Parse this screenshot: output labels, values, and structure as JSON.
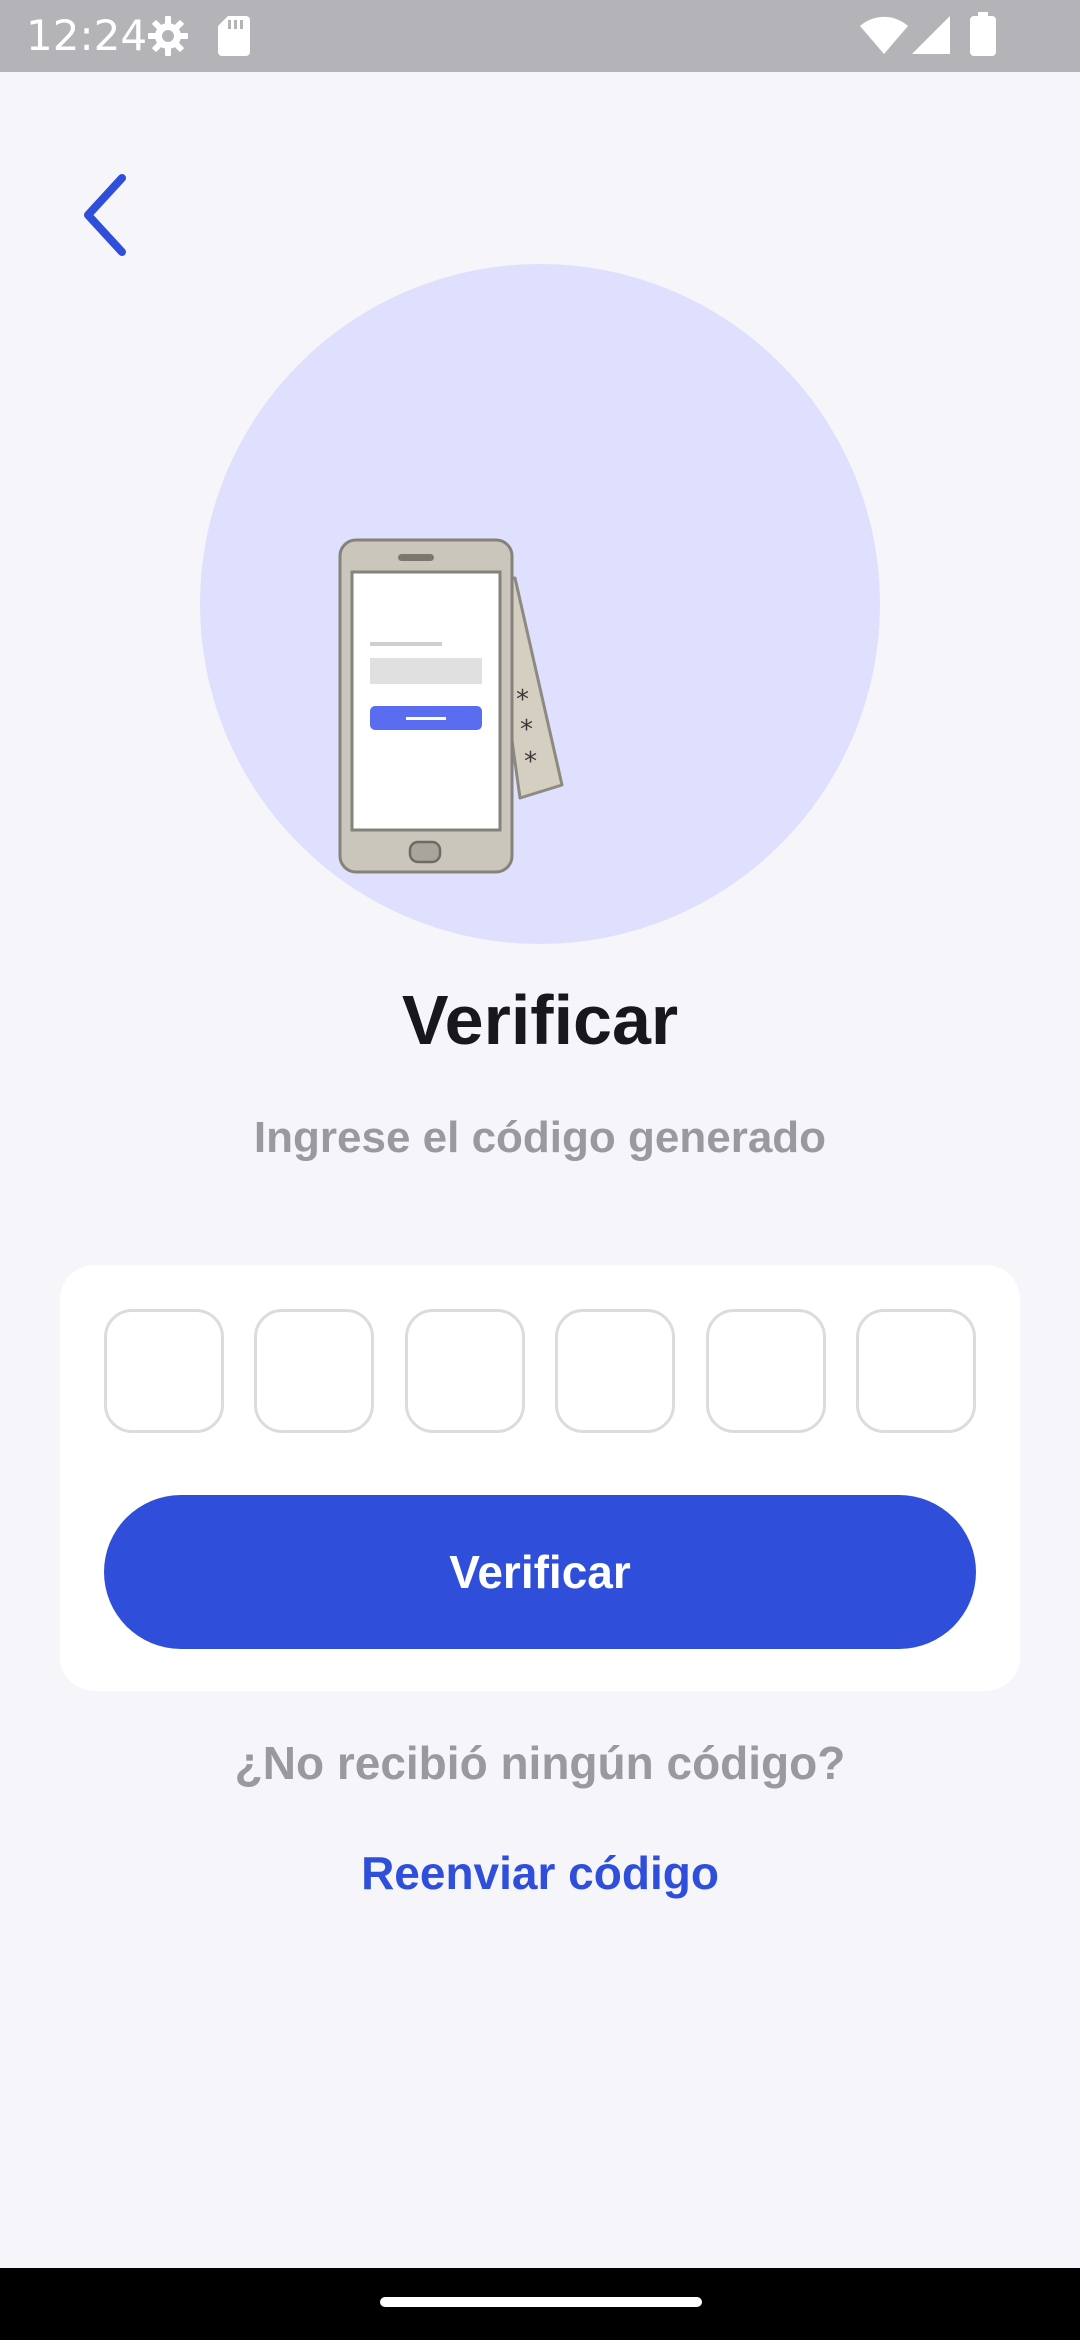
{
  "status_bar": {
    "time": "12:24",
    "icons": [
      "settings-gear-icon",
      "sd-card-icon",
      "wifi-icon",
      "cellular-signal-icon",
      "battery-icon"
    ]
  },
  "header": {
    "back_icon": "chevron-left-icon"
  },
  "hero": {
    "illustration": "phone-with-code-card-illustration",
    "circle_color": "#dfe0fd"
  },
  "main": {
    "title": "Verificar",
    "subtitle": "Ingrese el código generado"
  },
  "code_form": {
    "digits": [
      "",
      "",
      "",
      "",
      "",
      ""
    ],
    "verify_label": "Verificar"
  },
  "footer": {
    "no_code_text": "¿No recibió ningún código?",
    "resend_label": "Reenviar código"
  },
  "colors": {
    "accent": "#2f4fdb",
    "background": "#f5f5fa",
    "muted_text": "#9a9a9e",
    "title_text": "#18181c"
  }
}
